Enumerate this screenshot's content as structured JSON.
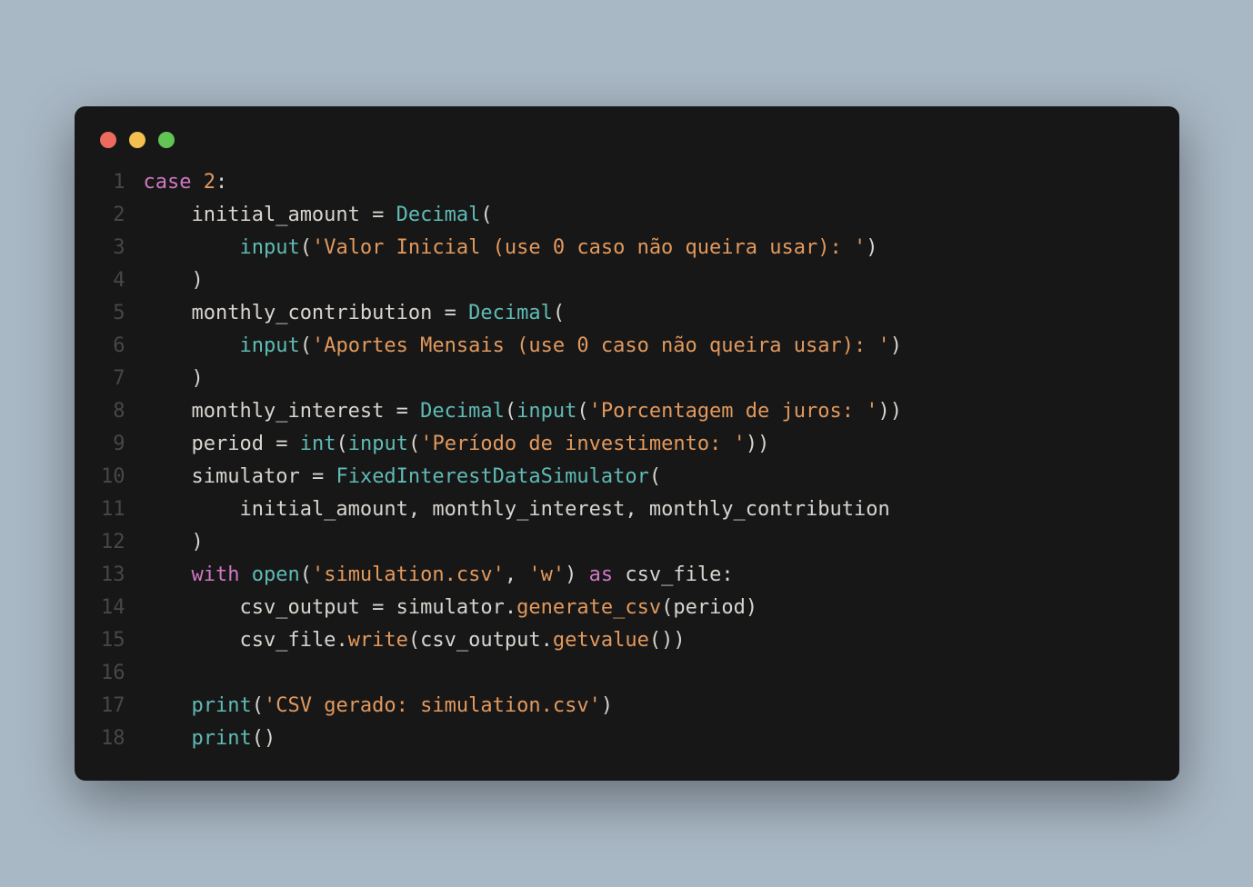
{
  "code": {
    "lines": [
      {
        "num": "1",
        "tokens": [
          {
            "cls": "tok-keyword",
            "text": "case"
          },
          {
            "cls": "tok-punct",
            "text": " "
          },
          {
            "cls": "tok-number",
            "text": "2"
          },
          {
            "cls": "tok-punct",
            "text": ":"
          }
        ]
      },
      {
        "num": "2",
        "tokens": [
          {
            "cls": "tok-punct",
            "text": "    "
          },
          {
            "cls": "tok-variable",
            "text": "initial_amount"
          },
          {
            "cls": "tok-punct",
            "text": " "
          },
          {
            "cls": "tok-operator",
            "text": "="
          },
          {
            "cls": "tok-punct",
            "text": " "
          },
          {
            "cls": "tok-function",
            "text": "Decimal"
          },
          {
            "cls": "tok-punct",
            "text": "("
          }
        ]
      },
      {
        "num": "3",
        "tokens": [
          {
            "cls": "tok-punct",
            "text": "        "
          },
          {
            "cls": "tok-builtin",
            "text": "input"
          },
          {
            "cls": "tok-punct",
            "text": "("
          },
          {
            "cls": "tok-string",
            "text": "'Valor Inicial (use 0 caso não queira usar): '"
          },
          {
            "cls": "tok-punct",
            "text": ")"
          }
        ]
      },
      {
        "num": "4",
        "tokens": [
          {
            "cls": "tok-punct",
            "text": "    )"
          }
        ]
      },
      {
        "num": "5",
        "tokens": [
          {
            "cls": "tok-punct",
            "text": "    "
          },
          {
            "cls": "tok-variable",
            "text": "monthly_contribution"
          },
          {
            "cls": "tok-punct",
            "text": " "
          },
          {
            "cls": "tok-operator",
            "text": "="
          },
          {
            "cls": "tok-punct",
            "text": " "
          },
          {
            "cls": "tok-function",
            "text": "Decimal"
          },
          {
            "cls": "tok-punct",
            "text": "("
          }
        ]
      },
      {
        "num": "6",
        "tokens": [
          {
            "cls": "tok-punct",
            "text": "        "
          },
          {
            "cls": "tok-builtin",
            "text": "input"
          },
          {
            "cls": "tok-punct",
            "text": "("
          },
          {
            "cls": "tok-string",
            "text": "'Aportes Mensais (use 0 caso não queira usar): '"
          },
          {
            "cls": "tok-punct",
            "text": ")"
          }
        ]
      },
      {
        "num": "7",
        "tokens": [
          {
            "cls": "tok-punct",
            "text": "    )"
          }
        ]
      },
      {
        "num": "8",
        "tokens": [
          {
            "cls": "tok-punct",
            "text": "    "
          },
          {
            "cls": "tok-variable",
            "text": "monthly_interest"
          },
          {
            "cls": "tok-punct",
            "text": " "
          },
          {
            "cls": "tok-operator",
            "text": "="
          },
          {
            "cls": "tok-punct",
            "text": " "
          },
          {
            "cls": "tok-function",
            "text": "Decimal"
          },
          {
            "cls": "tok-punct",
            "text": "("
          },
          {
            "cls": "tok-builtin",
            "text": "input"
          },
          {
            "cls": "tok-punct",
            "text": "("
          },
          {
            "cls": "tok-string",
            "text": "'Porcentagem de juros: '"
          },
          {
            "cls": "tok-punct",
            "text": "))"
          }
        ]
      },
      {
        "num": "9",
        "tokens": [
          {
            "cls": "tok-punct",
            "text": "    "
          },
          {
            "cls": "tok-variable",
            "text": "period"
          },
          {
            "cls": "tok-punct",
            "text": " "
          },
          {
            "cls": "tok-operator",
            "text": "="
          },
          {
            "cls": "tok-punct",
            "text": " "
          },
          {
            "cls": "tok-builtin",
            "text": "int"
          },
          {
            "cls": "tok-punct",
            "text": "("
          },
          {
            "cls": "tok-builtin",
            "text": "input"
          },
          {
            "cls": "tok-punct",
            "text": "("
          },
          {
            "cls": "tok-string",
            "text": "'Período de investimento: '"
          },
          {
            "cls": "tok-punct",
            "text": "))"
          }
        ]
      },
      {
        "num": "10",
        "tokens": [
          {
            "cls": "tok-punct",
            "text": "    "
          },
          {
            "cls": "tok-variable",
            "text": "simulator"
          },
          {
            "cls": "tok-punct",
            "text": " "
          },
          {
            "cls": "tok-operator",
            "text": "="
          },
          {
            "cls": "tok-punct",
            "text": " "
          },
          {
            "cls": "tok-function",
            "text": "FixedInterestDataSimulator"
          },
          {
            "cls": "tok-punct",
            "text": "("
          }
        ]
      },
      {
        "num": "11",
        "tokens": [
          {
            "cls": "tok-punct",
            "text": "        "
          },
          {
            "cls": "tok-variable",
            "text": "initial_amount"
          },
          {
            "cls": "tok-punct",
            "text": ", "
          },
          {
            "cls": "tok-variable",
            "text": "monthly_interest"
          },
          {
            "cls": "tok-punct",
            "text": ", "
          },
          {
            "cls": "tok-variable",
            "text": "monthly_contribution"
          }
        ]
      },
      {
        "num": "12",
        "tokens": [
          {
            "cls": "tok-punct",
            "text": "    )"
          }
        ]
      },
      {
        "num": "13",
        "tokens": [
          {
            "cls": "tok-punct",
            "text": "    "
          },
          {
            "cls": "tok-keyword",
            "text": "with"
          },
          {
            "cls": "tok-punct",
            "text": " "
          },
          {
            "cls": "tok-builtin",
            "text": "open"
          },
          {
            "cls": "tok-punct",
            "text": "("
          },
          {
            "cls": "tok-string",
            "text": "'simulation.csv'"
          },
          {
            "cls": "tok-punct",
            "text": ", "
          },
          {
            "cls": "tok-string",
            "text": "'w'"
          },
          {
            "cls": "tok-punct",
            "text": ") "
          },
          {
            "cls": "tok-keyword",
            "text": "as"
          },
          {
            "cls": "tok-punct",
            "text": " "
          },
          {
            "cls": "tok-variable",
            "text": "csv_file"
          },
          {
            "cls": "tok-punct",
            "text": ":"
          }
        ]
      },
      {
        "num": "14",
        "tokens": [
          {
            "cls": "tok-punct",
            "text": "        "
          },
          {
            "cls": "tok-variable",
            "text": "csv_output"
          },
          {
            "cls": "tok-punct",
            "text": " "
          },
          {
            "cls": "tok-operator",
            "text": "="
          },
          {
            "cls": "tok-punct",
            "text": " "
          },
          {
            "cls": "tok-variable",
            "text": "simulator"
          },
          {
            "cls": "tok-punct",
            "text": "."
          },
          {
            "cls": "tok-method",
            "text": "generate_csv"
          },
          {
            "cls": "tok-punct",
            "text": "("
          },
          {
            "cls": "tok-variable",
            "text": "period"
          },
          {
            "cls": "tok-punct",
            "text": ")"
          }
        ]
      },
      {
        "num": "15",
        "tokens": [
          {
            "cls": "tok-punct",
            "text": "        "
          },
          {
            "cls": "tok-variable",
            "text": "csv_file"
          },
          {
            "cls": "tok-punct",
            "text": "."
          },
          {
            "cls": "tok-method",
            "text": "write"
          },
          {
            "cls": "tok-punct",
            "text": "("
          },
          {
            "cls": "tok-variable",
            "text": "csv_output"
          },
          {
            "cls": "tok-punct",
            "text": "."
          },
          {
            "cls": "tok-method",
            "text": "getvalue"
          },
          {
            "cls": "tok-punct",
            "text": "())"
          }
        ]
      },
      {
        "num": "16",
        "tokens": []
      },
      {
        "num": "17",
        "tokens": [
          {
            "cls": "tok-punct",
            "text": "    "
          },
          {
            "cls": "tok-builtin",
            "text": "print"
          },
          {
            "cls": "tok-punct",
            "text": "("
          },
          {
            "cls": "tok-string",
            "text": "'CSV gerado: simulation.csv'"
          },
          {
            "cls": "tok-punct",
            "text": ")"
          }
        ]
      },
      {
        "num": "18",
        "tokens": [
          {
            "cls": "tok-punct",
            "text": "    "
          },
          {
            "cls": "tok-builtin",
            "text": "print"
          },
          {
            "cls": "tok-punct",
            "text": "()"
          }
        ]
      }
    ]
  }
}
